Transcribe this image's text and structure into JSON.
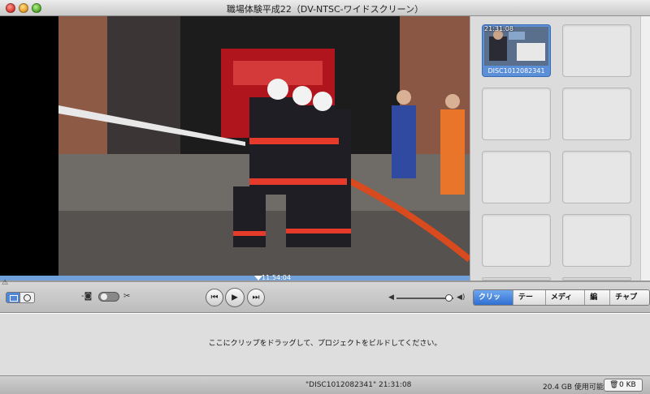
{
  "window": {
    "title": "職場体験平成22（DV-NTSC-ワイドスクリーン）"
  },
  "browser": {
    "clip": {
      "time": "21:31:08",
      "name": "DISC1012082341"
    }
  },
  "viewer": {
    "timecode": "11:54:04"
  },
  "toolbar": {
    "warning": "⚠",
    "tabs": [
      {
        "label": "クリップ",
        "active": true
      },
      {
        "label": "テーマ",
        "active": false
      },
      {
        "label": "メディア",
        "active": false
      },
      {
        "label": "編集",
        "active": false
      },
      {
        "label": "チャプタ",
        "active": false
      }
    ]
  },
  "project": {
    "hint": "ここにクリップをドラッグして、プロジェクトをビルドしてください。"
  },
  "status": {
    "clip_info": "\"DISC1012082341\" 21:31:08",
    "free_space": "20.4 GB 使用可能",
    "trash_size": "0 KB"
  }
}
